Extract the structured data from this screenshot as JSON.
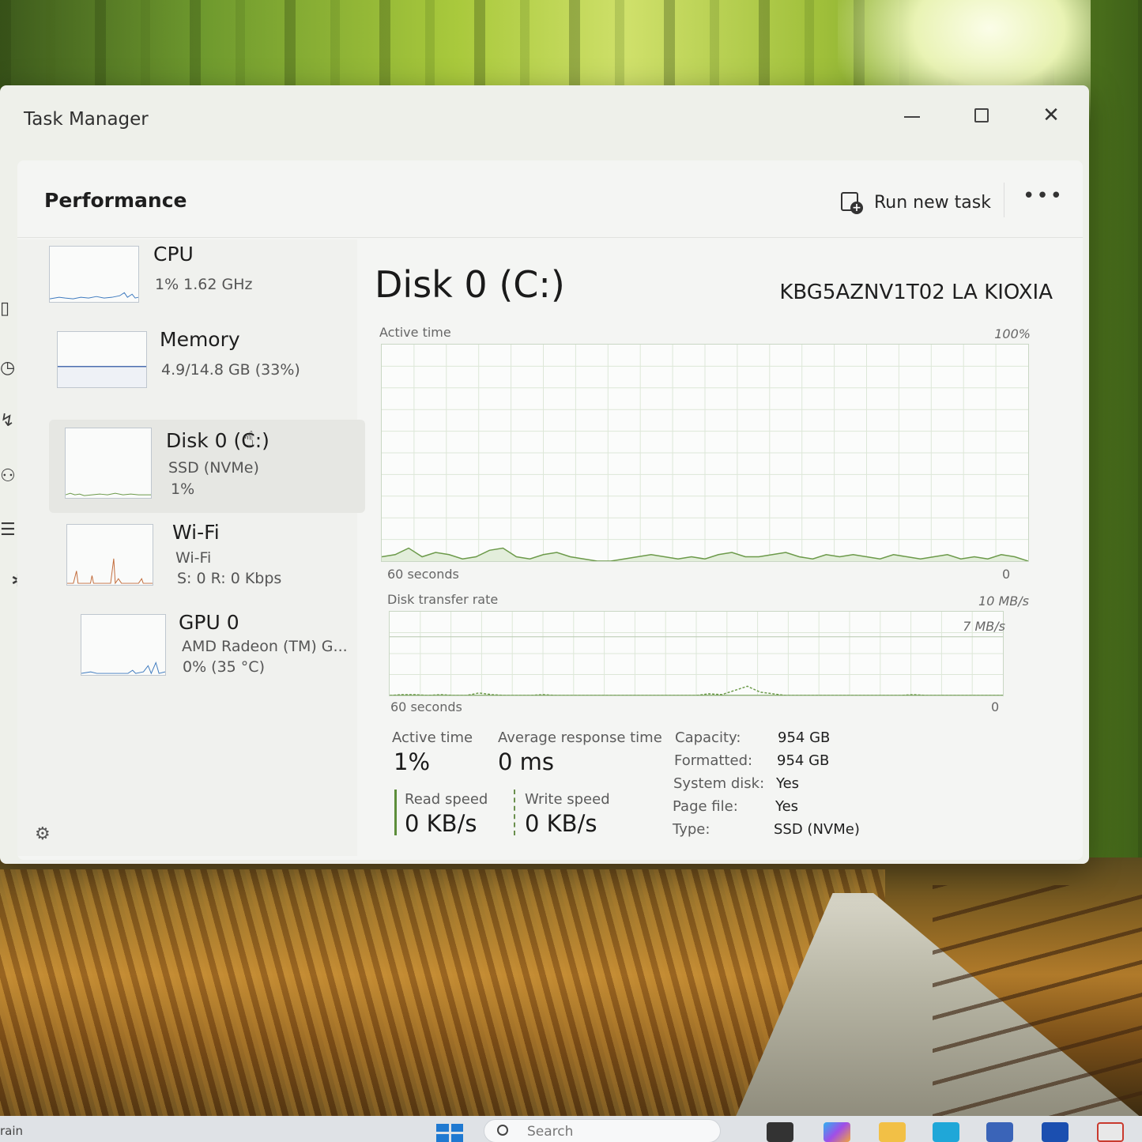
{
  "window": {
    "title": "Task Manager",
    "controls": {
      "minimize": "minimize",
      "maximize": "maximize",
      "close": "✕"
    }
  },
  "header": {
    "title": "Performance",
    "run_new_task": "Run new task",
    "more": "•••"
  },
  "sidebar": {
    "items": [
      {
        "name": "CPU",
        "line1": "1%  1.62 GHz",
        "line2": ""
      },
      {
        "name": "Memory",
        "line1": "4.9/14.8 GB (33%)",
        "line2": ""
      },
      {
        "name": "Disk 0 (C:)",
        "line1": "SSD (NVMe)",
        "line2": "1%"
      },
      {
        "name": "Wi-Fi",
        "line1": "Wi-Fi",
        "line2": "S: 0  R: 0 Kbps"
      },
      {
        "name": "GPU 0",
        "line1": "AMD Radeon (TM) G...",
        "line2": "0%  (35 °C)"
      }
    ],
    "selected": "Disk 0 (C:)"
  },
  "main": {
    "title": "Disk 0 (C:)",
    "model": "KBG5AZNV1T02 LA KIOXIA",
    "active_graph": {
      "label": "Active time",
      "max_label": "100%",
      "time_label": "60 seconds",
      "min_label": "0",
      "samples": [
        2,
        3,
        6,
        2,
        4,
        3,
        1,
        2,
        5,
        6,
        2,
        1,
        3,
        4,
        2,
        1,
        0,
        0,
        1,
        2,
        3,
        2,
        1,
        2,
        1,
        3,
        4,
        2,
        2,
        3,
        4,
        2,
        1,
        3,
        2,
        3,
        2,
        1,
        3,
        2,
        1,
        2,
        3,
        1,
        2,
        1,
        3,
        2,
        0
      ]
    },
    "transfer_graph": {
      "label": "Disk transfer rate",
      "max_label": "10 MB/s",
      "mid_label": "7 MB/s",
      "time_label": "60 seconds",
      "min_label": "0",
      "read_samples": [
        0,
        0,
        0,
        0,
        0,
        0,
        0,
        0,
        0,
        0,
        0,
        0,
        0,
        0,
        0,
        0,
        0,
        0,
        0,
        0,
        0,
        0,
        0,
        0,
        0,
        0,
        0,
        0,
        0,
        0,
        0,
        0,
        0,
        0,
        0,
        0,
        0,
        0,
        0,
        0,
        0,
        0,
        0,
        0,
        0,
        0,
        0,
        0,
        0
      ],
      "write_samples": [
        0,
        0.1,
        0.1,
        0,
        0.1,
        0,
        0,
        0.3,
        0.1,
        0,
        0,
        0,
        0.1,
        0,
        0,
        0,
        0,
        0,
        0,
        0,
        0,
        0,
        0,
        0,
        0,
        0.2,
        0.1,
        0.6,
        1.1,
        0.4,
        0.2,
        0,
        0,
        0,
        0,
        0,
        0,
        0,
        0,
        0,
        0,
        0.1,
        0,
        0,
        0,
        0,
        0,
        0,
        0
      ]
    },
    "stats": {
      "active_time_label": "Active time",
      "active_time_value": "1%",
      "avg_response_label": "Average response time",
      "avg_response_value": "0 ms",
      "read_label": "Read speed",
      "read_value": "0 KB/s",
      "write_label": "Write speed",
      "write_value": "0 KB/s"
    },
    "properties": [
      {
        "label": "Capacity:",
        "value": "954 GB"
      },
      {
        "label": "Formatted:",
        "value": "954 GB"
      },
      {
        "label": "System disk:",
        "value": "Yes"
      },
      {
        "label": "Page file:",
        "value": "Yes"
      },
      {
        "label": "Type:",
        "value": "SSD (NVMe)"
      }
    ]
  },
  "taskbar": {
    "weather": "rain",
    "search_placeholder": "Search"
  },
  "colors": {
    "graph_line": "#6c9a4a",
    "graph_fill": "#e3eedb",
    "grid": "#dde7d8",
    "accent_blue": "#1f79d1"
  }
}
